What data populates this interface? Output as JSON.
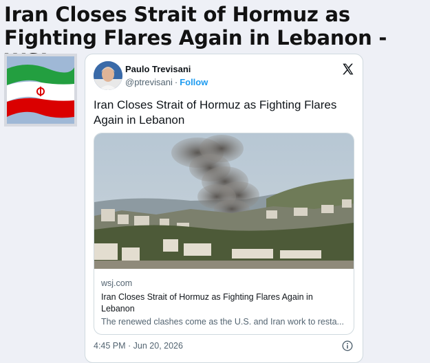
{
  "headline": "Iran Closes Strait of Hormuz as Fighting Flares Again in Lebanon - WSJ",
  "thumbnail": {
    "icon": "iran-flag-icon"
  },
  "tweet": {
    "author": {
      "name": "Paulo Trevisani",
      "handle": "@ptrevisani",
      "separator": "·",
      "follow_label": "Follow",
      "avatar_icon": "avatar"
    },
    "platform_icon": "x-logo-icon",
    "text": "Iran Closes Strait of Hormuz as Fighting Flares Again in Lebanon",
    "card": {
      "image_icon": "smoke-over-town-photo",
      "domain": "wsj.com",
      "title": "Iran Closes Strait of Hormuz as Fighting Flares Again in Lebanon",
      "description": "The renewed clashes come as the U.S. and Iran work to resta..."
    },
    "timestamp": "4:45 PM · Jun 20, 2026",
    "info_icon": "info-icon"
  },
  "colors": {
    "link_blue": "#1d9bf0",
    "text_primary": "#0f1419",
    "text_secondary": "#536471",
    "border": "#cfd9de",
    "page_background": "#eef0f6"
  }
}
